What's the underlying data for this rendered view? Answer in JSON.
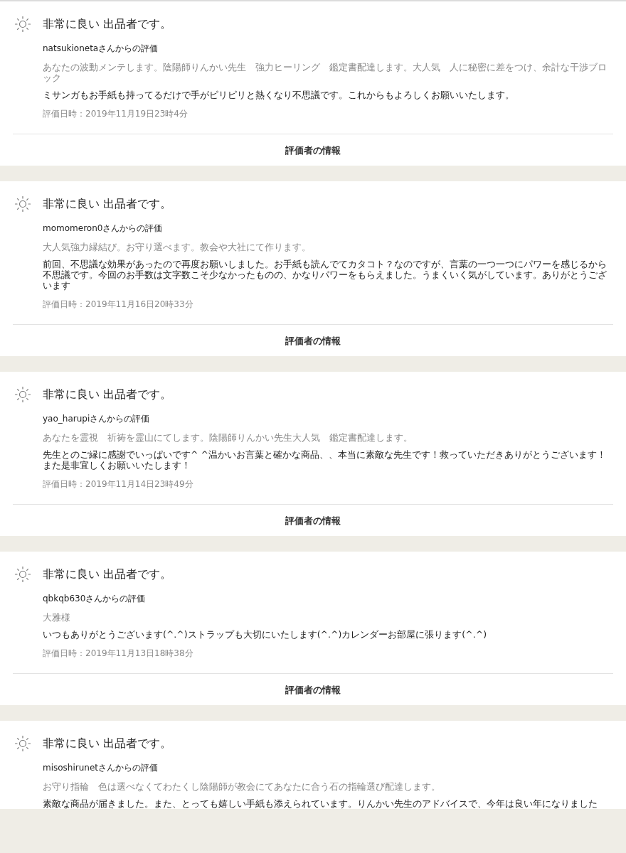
{
  "reviews": [
    {
      "rating": "非常に良い 出品者です。",
      "reviewer": "natsukionetaさんからの評価",
      "item": "あなたの波動メンテします。陰陽師りんかい先生　強力ヒーリング　鑑定書配達します。大人気　人に秘密に差をつけ、余計な干渉ブロック",
      "comment": "ミサンガもお手紙も持ってるだけで手がピリピリと熱くなり不思議です。これからもよろしくお願いいたします。",
      "date": "評価日時：2019年11月19日23時4分",
      "link": "評価者の情報"
    },
    {
      "rating": "非常に良い 出品者です。",
      "reviewer": "momomeron0さんからの評価",
      "item": "大人気強力縁結び。お守り選べます。教会や大社にて作ります。",
      "comment": "前回、不思議な効果があったので再度お願いしました。お手紙も読んでてカタコト？なのですが、言葉の一つ一つにパワーを感じるから不思議です。今回のお手数は文字数こそ少なかったものの、かなりパワーをもらえました。うまくいく気がしています。ありがとうございます",
      "date": "評価日時：2019年11月16日20時33分",
      "link": "評価者の情報"
    },
    {
      "rating": "非常に良い 出品者です。",
      "reviewer": "yao_harupiさんからの評価",
      "item": "あなたを霊視　祈祷を霊山にてします。陰陽師りんかい先生大人気　鑑定書配達します。",
      "comment": "先生とのご縁に感謝でいっぱいです^ ^温かいお言葉と確かな商品、、本当に素敵な先生です！救っていただきありがとうございます！また是非宜しくお願いいたします！",
      "date": "評価日時：2019年11月14日23時49分",
      "link": "評価者の情報"
    },
    {
      "rating": "非常に良い 出品者です。",
      "reviewer": "qbkqb630さんからの評価",
      "item": "大雅様",
      "comment": "いつもありがとうございます(^.^)ストラップも大切にいたします(^.^)カレンダーお部屋に張ります(^.^)",
      "date": "評価日時：2019年11月13日18時38分",
      "link": "評価者の情報"
    },
    {
      "rating": "非常に良い 出品者です。",
      "reviewer": "misoshirunetさんからの評価",
      "item": "お守り指輪　色は選べなくてわたくし陰陽師が教会にてあなたに合う石の指輪選び配達します。",
      "comment": "素敵な商品が届きました。また、とっても嬉しい手紙も添えられています。りんかい先生のアドバイスで、今年は良い年になりました"
    }
  ]
}
